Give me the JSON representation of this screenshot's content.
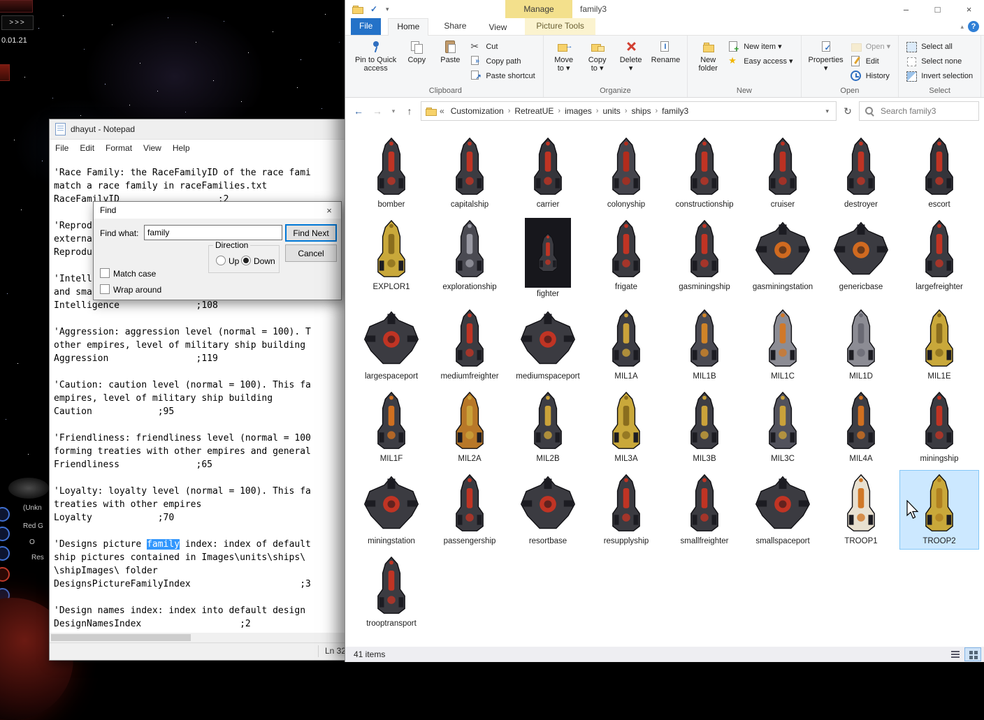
{
  "game": {
    "version": "0.01.21",
    "expand": ">>>",
    "hud": [
      "(Unkn",
      "Red G",
      "O",
      "Res"
    ]
  },
  "notepad": {
    "title": "dhayut - Notepad",
    "menus": [
      "File",
      "Edit",
      "Format",
      "View",
      "Help"
    ],
    "status": "Ln 32",
    "lines": [
      "'Race Family: the RaceFamilyID of the race fami",
      "match a race family in raceFamilies.txt",
      "RaceFamilyID                  ;2",
      "",
      "'Reprod",
      "externa",
      "Reprodu",
      "",
      "'Intell",
      "and sma",
      "Intelligence              ;108",
      "",
      "'Aggression: aggression level (normal = 100). T",
      "other empires, level of military ship building ",
      "Aggression                ;119",
      "",
      "'Caution: caution level (normal = 100). This fa",
      "empires, level of military ship building",
      "Caution            ;95",
      "",
      "'Friendliness: friendliness level (normal = 100",
      "forming treaties with other empires and general",
      "Friendliness              ;65",
      "",
      "'Loyalty: loyalty level (normal = 100). This fa",
      "treaties with other empires",
      "Loyalty            ;70",
      "",
      [
        {
          "t": "'Designs picture "
        },
        {
          "t": "family",
          "h": true
        },
        {
          "t": " index: index of default"
        }
      ],
      "ship pictures contained in Images\\units\\ships\\",
      "\\shipImages\\ folder",
      "DesignsPictureFamilyIndex                    ;3",
      "",
      "'Design names index: index into default design ",
      "DesignNamesIndex                  ;2"
    ]
  },
  "find_dialog": {
    "title": "Find",
    "close": "×",
    "find_what_label": "Find what:",
    "find_value": "family",
    "find_next_label": "Find Next",
    "cancel_label": "Cancel",
    "direction_label": "Direction",
    "up_label": "Up",
    "down_label": "Down",
    "down_checked": true,
    "match_case_label": "Match case",
    "wrap_around_label": "Wrap around"
  },
  "explorer": {
    "titlebar": {
      "manage": "Manage",
      "title": "family3",
      "controls": {
        "minimize": "–",
        "maximize": "□",
        "close": "×"
      },
      "qat_dropdown": "▾",
      "ribbon_collapse": "▴",
      "help": "?"
    },
    "ribbon": {
      "tabs": {
        "file": "File",
        "home": "Home",
        "share": "Share",
        "view": "View"
      },
      "tools_label": "Picture Tools",
      "groups": [
        {
          "label": "Clipboard",
          "big": [
            {
              "icon": "pin",
              "lines": [
                "Pin to Quick",
                "access"
              ]
            },
            {
              "icon": "copy",
              "lines": [
                "Copy"
              ]
            },
            {
              "icon": "paste",
              "lines": [
                "Paste"
              ]
            }
          ],
          "small": [
            {
              "icon": "cut",
              "label": "Cut"
            },
            {
              "icon": "copy-path",
              "label": "Copy path"
            },
            {
              "icon": "paste-shortcut",
              "label": "Paste shortcut"
            }
          ]
        },
        {
          "label": "Organize",
          "big": [
            {
              "icon": "move-to",
              "lines": [
                "Move",
                "to ▾"
              ]
            },
            {
              "icon": "copy-to",
              "lines": [
                "Copy",
                "to ▾"
              ]
            },
            {
              "icon": "delete",
              "lines": [
                "Delete",
                "▾"
              ]
            },
            {
              "icon": "rename",
              "lines": [
                "Rename"
              ]
            }
          ],
          "small": []
        },
        {
          "label": "New",
          "big": [
            {
              "icon": "new-folder",
              "lines": [
                "New",
                "folder"
              ]
            }
          ],
          "small": [
            {
              "icon": "new-item",
              "label": "New item ▾"
            },
            {
              "icon": "easy-access",
              "label": "Easy access ▾"
            }
          ]
        },
        {
          "label": "Open",
          "big": [
            {
              "icon": "properties",
              "lines": [
                "Properties",
                "▾"
              ]
            }
          ],
          "small": [
            {
              "icon": "open",
              "label": "Open ▾",
              "muted": true
            },
            {
              "icon": "edit",
              "label": "Edit"
            },
            {
              "icon": "history",
              "label": "History"
            }
          ]
        },
        {
          "label": "Select",
          "big": [],
          "small": [
            {
              "icon": "select-all",
              "label": "Select all"
            },
            {
              "icon": "select-none",
              "label": "Select none"
            },
            {
              "icon": "invert-selection",
              "label": "Invert selection"
            }
          ]
        }
      ]
    },
    "nav": {
      "back": "←",
      "forward": "→",
      "history": "▾",
      "up": "↑",
      "truncate": "«",
      "separator": "›",
      "address_dropdown": "▾",
      "refresh": "↻"
    },
    "breadcrumb": [
      "Customization",
      "RetreatUE",
      "images",
      "units",
      "ships",
      "family3"
    ],
    "search": {
      "placeholder": "Search family3"
    },
    "status": {
      "items": "41 items"
    },
    "items": [
      {
        "label": "bomber",
        "hull": "#3b3b41",
        "accent": "#c03424"
      },
      {
        "label": "capitalship",
        "hull": "#3b3b41",
        "accent": "#c03424"
      },
      {
        "label": "carrier",
        "hull": "#35353b",
        "accent": "#c03424"
      },
      {
        "label": "colonyship",
        "hull": "#45454d",
        "accent": "#b22c1c"
      },
      {
        "label": "constructionship",
        "hull": "#3b3b41",
        "accent": "#c03424"
      },
      {
        "label": "cruiser",
        "hull": "#3b3b41",
        "accent": "#bb3122"
      },
      {
        "label": "destroyer",
        "hull": "#3b3b41",
        "accent": "#c03424"
      },
      {
        "label": "escort",
        "hull": "#34343a",
        "accent": "#c03424"
      },
      {
        "label": "EXPLOR1",
        "hull": "#c9a83a",
        "accent": "#8a6d1e"
      },
      {
        "label": "explorationship",
        "hull": "#4a4a52",
        "accent": "#9a9aa4"
      },
      {
        "label": "fighter",
        "hull": "#3b3b41",
        "accent": "#c03424",
        "kind": "small"
      },
      {
        "label": "frigate",
        "hull": "#3b3b41",
        "accent": "#c03424"
      },
      {
        "label": "gasminingship",
        "hull": "#3b3b41",
        "accent": "#c03424"
      },
      {
        "label": "gasminingstation",
        "hull": "#3b3b41",
        "accent": "#d06a20",
        "kind": "station"
      },
      {
        "label": "genericbase",
        "hull": "#3b3b41",
        "accent": "#d06a20",
        "kind": "station"
      },
      {
        "label": "largefreighter",
        "hull": "#3b3b41",
        "accent": "#c03424"
      },
      {
        "label": "largespaceport",
        "hull": "#3b3b41",
        "accent": "#c03424",
        "kind": "station"
      },
      {
        "label": "mediumfreighter",
        "hull": "#3b3b41",
        "accent": "#c03424"
      },
      {
        "label": "mediumspaceport",
        "hull": "#3b3b41",
        "accent": "#c03424",
        "kind": "station"
      },
      {
        "label": "MIL1A",
        "hull": "#3d3d44",
        "accent": "#caa23a"
      },
      {
        "label": "MIL1B",
        "hull": "#4a4a52",
        "accent": "#d08428"
      },
      {
        "label": "MIL1C",
        "hull": "#8c8c94",
        "accent": "#d07828"
      },
      {
        "label": "MIL1D",
        "hull": "#8c8c94",
        "accent": "#6a6a74"
      },
      {
        "label": "MIL1E",
        "hull": "#c9a83a",
        "accent": "#8a6d1e"
      },
      {
        "label": "MIL1F",
        "hull": "#3d3d44",
        "accent": "#d07020"
      },
      {
        "label": "MIL2A",
        "hull": "#b87828",
        "accent": "#caa23a"
      },
      {
        "label": "MIL2B",
        "hull": "#3d3d44",
        "accent": "#caa23a"
      },
      {
        "label": "MIL3A",
        "hull": "#c9a83a",
        "accent": "#8a6d1e"
      },
      {
        "label": "MIL3B",
        "hull": "#3d3d44",
        "accent": "#caa23a"
      },
      {
        "label": "MIL3C",
        "hull": "#52525c",
        "accent": "#caa23a"
      },
      {
        "label": "MIL4A",
        "hull": "#3d3d44",
        "accent": "#d07020"
      },
      {
        "label": "miningship",
        "hull": "#3b3b41",
        "accent": "#c03424"
      },
      {
        "label": "miningstation",
        "hull": "#3b3b41",
        "accent": "#c03424",
        "kind": "station"
      },
      {
        "label": "passengership",
        "hull": "#3b3b41",
        "accent": "#c03424"
      },
      {
        "label": "resortbase",
        "hull": "#3b3b41",
        "accent": "#c03424",
        "kind": "station"
      },
      {
        "label": "resupplyship",
        "hull": "#3b3b41",
        "accent": "#c03424"
      },
      {
        "label": "smallfreighter",
        "hull": "#3b3b41",
        "accent": "#c03424"
      },
      {
        "label": "smallspaceport",
        "hull": "#3b3b41",
        "accent": "#c03424",
        "kind": "station"
      },
      {
        "label": "TROOP1",
        "hull": "#e8e0d0",
        "accent": "#d07828"
      },
      {
        "label": "TROOP2",
        "hull": "#c9a83a",
        "accent": "#b08020",
        "selected": true
      },
      {
        "label": "trooptransport",
        "hull": "#3b3b41",
        "accent": "#c03424"
      }
    ]
  }
}
